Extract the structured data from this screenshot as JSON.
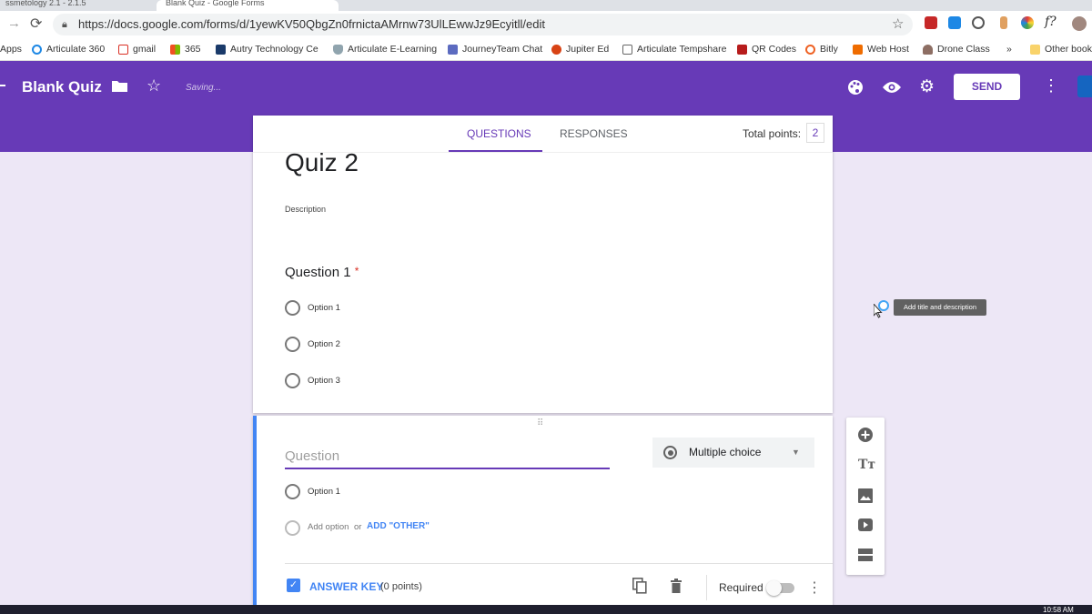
{
  "browser": {
    "tabs": [
      "ssmetology 2.1 - 2.1.5",
      "Blank Quiz - Google Forms"
    ],
    "url": "https://docs.google.com/forms/d/1yewKV50QbgZn0frnictaAMrnw73UlLEwwJz9Ecyitll/edit",
    "bookmarks": [
      "Apps",
      "Articulate 360",
      "gmail",
      "365",
      "Autry Technology Ce",
      "Articulate E-Learning",
      "JourneyTeam Chat",
      "Jupiter Ed",
      "Articulate Tempshare",
      "QR Codes",
      "Bitly",
      "Web Host",
      "Drone Class",
      "»",
      "Other book"
    ]
  },
  "header": {
    "title": "Blank Quiz",
    "status": "Saving...",
    "send_label": "SEND"
  },
  "form": {
    "tabs": {
      "questions": "QUESTIONS",
      "responses": "RESPONSES"
    },
    "total_points_label": "Total points:",
    "total_points": "2",
    "title": "Quiz 2",
    "description": "Description",
    "question1": {
      "title": "Question 1",
      "required_mark": "*",
      "options": [
        "Option 1",
        "Option 2",
        "Option 3"
      ]
    },
    "question2": {
      "placeholder": "Question",
      "type": "Multiple choice",
      "option": "Option 1",
      "add_option": "Add option",
      "or": "or",
      "add_other": "ADD \"OTHER\"",
      "answer_key": "ANSWER KEY",
      "points": "(0 points)",
      "required_label": "Required"
    }
  },
  "tooltip": "Add title and description",
  "taskbar": {
    "time": "10:58 AM"
  },
  "colors": {
    "accent": "#673ab7",
    "background": "#ede7f6",
    "blue": "#4285f4"
  }
}
